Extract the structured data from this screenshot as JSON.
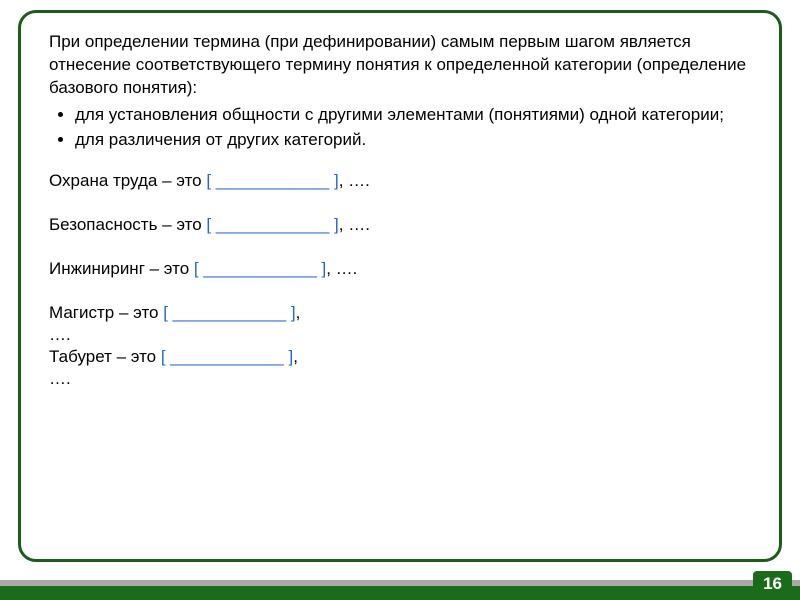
{
  "intro": "При определении термина (при дефинировании) самым первым шагом является отнесение соответствующего термину понятия к определенной категории (определение базового понятия):",
  "bullets": [
    "для установления общности с другими элементами (понятиями) одной категории;",
    "для различения от других категорий."
  ],
  "blank": "[ ____________  ]",
  "tail_comma_ellipsis": ", ….",
  "tail_comma": ",",
  "tail_ellipsis": "….",
  "examples": {
    "item1_lead": "Охрана труда – это ",
    "item2_lead": "Безопасность – это ",
    "item3_lead": "Инжиниринг – это ",
    "item4_lead": "Магистр – это ",
    "item5_lead": "Табурет – это "
  },
  "page_number": "16"
}
